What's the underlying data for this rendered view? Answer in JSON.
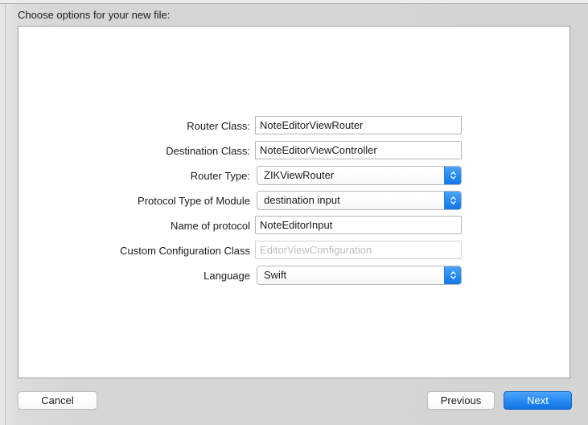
{
  "dialog": {
    "prompt": "Choose options for your new file:"
  },
  "form": {
    "rows": [
      {
        "label": "Router Class:",
        "control": "textfield",
        "value": "NoteEditorViewRouter",
        "placeholder": ""
      },
      {
        "label": "Destination Class:",
        "control": "textfield",
        "value": "NoteEditorViewController",
        "placeholder": ""
      },
      {
        "label": "Router Type:",
        "control": "popup",
        "value": "ZIKViewRouter"
      },
      {
        "label": "Protocol Type of Module",
        "control": "popup",
        "value": "destination input"
      },
      {
        "label": "Name of protocol",
        "control": "textfield",
        "value": "NoteEditorInput",
        "placeholder": ""
      },
      {
        "label": "Custom Configuration Class",
        "control": "textfield",
        "value": "",
        "placeholder": "EditorViewConfiguration"
      },
      {
        "label": "Language",
        "control": "popup",
        "value": "Swift"
      }
    ]
  },
  "footer": {
    "cancel_label": "Cancel",
    "previous_label": "Previous",
    "next_label": "Next"
  },
  "colors": {
    "accent_blue": "#2a8cf0",
    "default_button_blue": "#0f73e6",
    "panel_border": "#a0a0a0",
    "placeholder_text": "#bdbdbd"
  }
}
